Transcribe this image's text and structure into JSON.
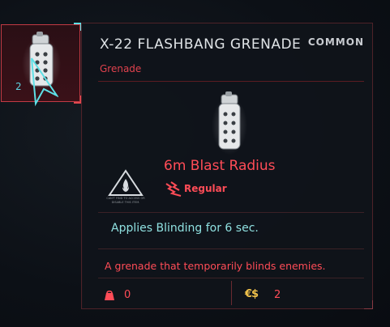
{
  "slot": {
    "quantity": "2",
    "icon": "grenade-icon"
  },
  "item": {
    "name": "X-22 FLASHBANG GRENADE",
    "rarity": "COMMON",
    "category": "Grenade",
    "stat_main": "6m Blast Radius",
    "stat_sub": "Regular",
    "warning_text": "CAN'T FIND TO ACCESS OR DISABLE THIS ITEM.",
    "effect": "Applies Blinding for 6 sec.",
    "description": "A grenade that temporarily blinds enemies.",
    "weight": "0",
    "price_currency": "€$",
    "price": "2"
  },
  "colors": {
    "accent_red": "#ff4c57",
    "cyan": "#5ee0e6",
    "effect_cyan": "#8fe0e0",
    "gold": "#f1c24a"
  }
}
